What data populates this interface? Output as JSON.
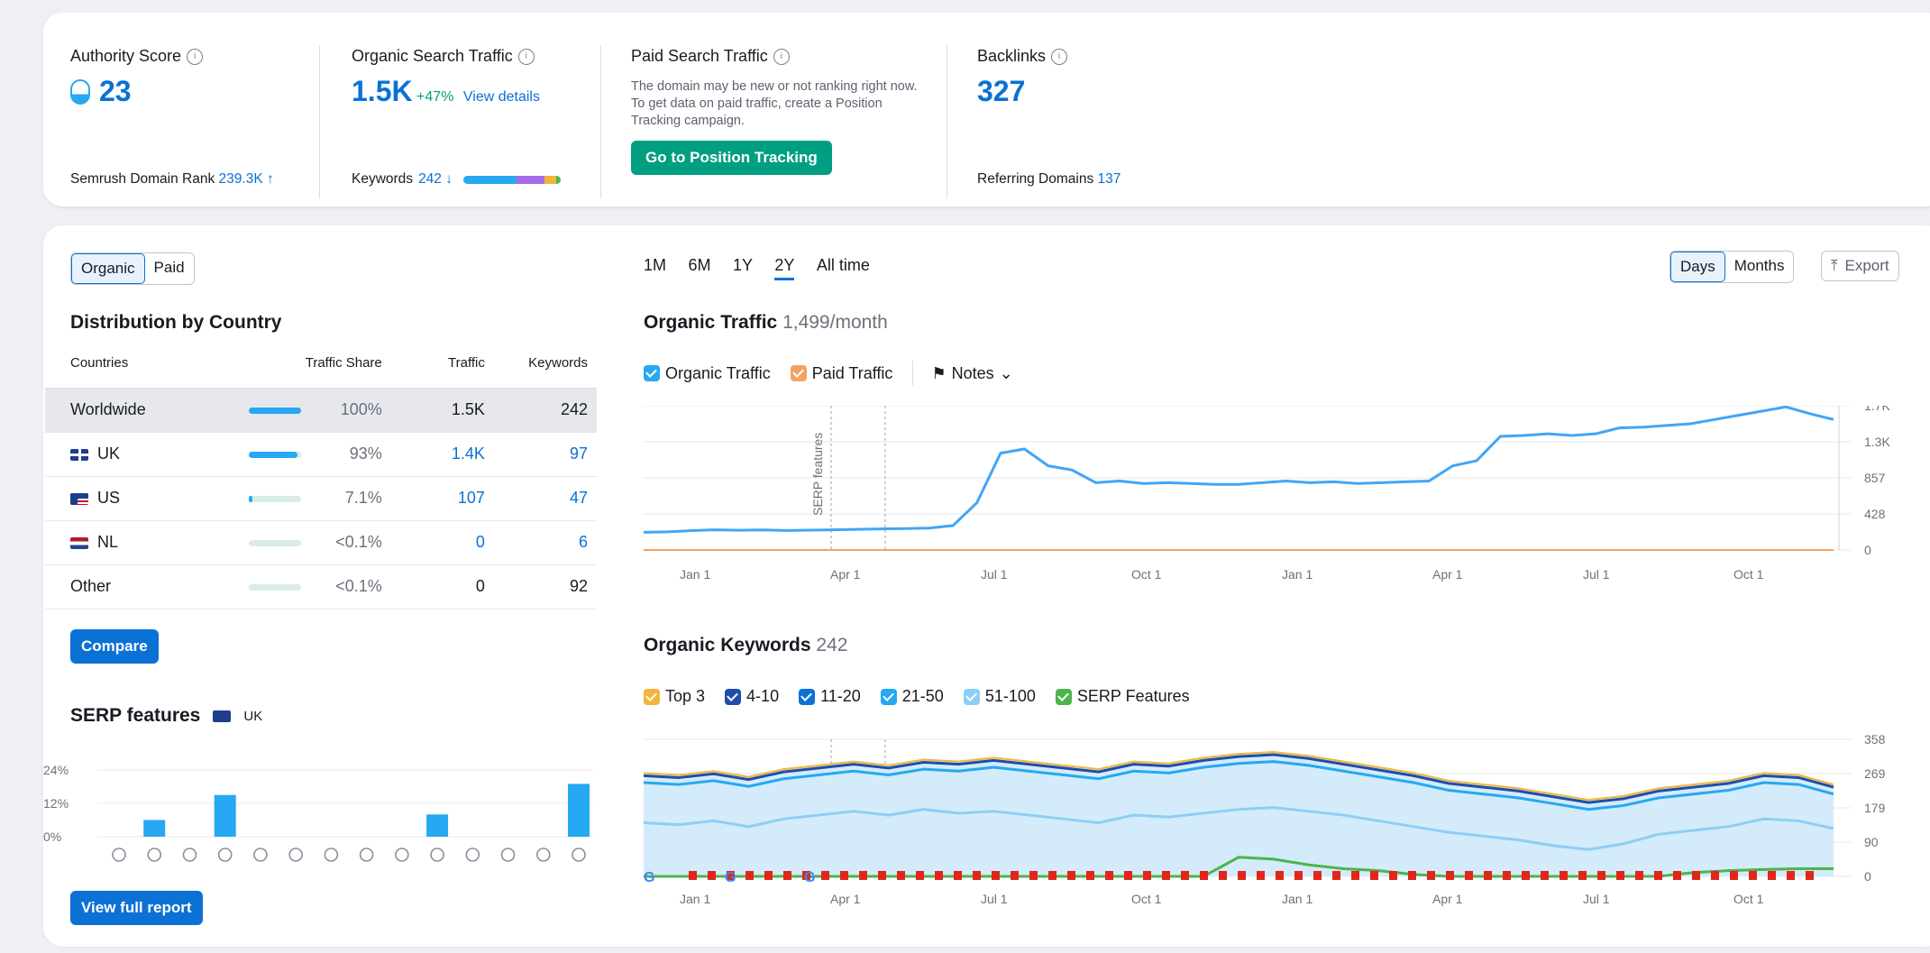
{
  "header": {
    "authority": {
      "label": "Authority Score",
      "value": "23",
      "foot_label": "Semrush Domain Rank",
      "foot_value": "239.3K ↑"
    },
    "organic": {
      "label": "Organic Search Traffic",
      "value": "1.5K",
      "change": "+47%",
      "link": "View details",
      "foot_label": "Keywords",
      "foot_value": "242 ↓"
    },
    "paid": {
      "label": "Paid Search Traffic",
      "text": "The domain may be new or not ranking right now. To get data on paid traffic, create a Position Tracking campaign.",
      "button": "Go to Position Tracking"
    },
    "backlinks": {
      "label": "Backlinks",
      "value": "327",
      "foot_label": "Referring Domains",
      "foot_value": "137"
    }
  },
  "left": {
    "toggle": [
      "Organic",
      "Paid"
    ],
    "dist_title": "Distribution by Country",
    "columns": [
      "Countries",
      "Traffic Share",
      "Traffic",
      "Keywords"
    ],
    "rows": [
      {
        "country": "Worldwide",
        "share": "100%",
        "share_frac": 1.0,
        "traffic": "1.5K",
        "keywords": "242",
        "flag": ""
      },
      {
        "country": "UK",
        "share": "93%",
        "share_frac": 0.93,
        "traffic": "1.4K",
        "keywords": "97",
        "flag": "uk"
      },
      {
        "country": "US",
        "share": "7.1%",
        "share_frac": 0.071,
        "traffic": "107",
        "keywords": "47",
        "flag": "us"
      },
      {
        "country": "NL",
        "share": "<0.1%",
        "share_frac": 0.0,
        "traffic": "0",
        "keywords": "6",
        "flag": "nl"
      },
      {
        "country": "Other",
        "share": "<0.1%",
        "share_frac": 0.0,
        "traffic": "0",
        "keywords": "92",
        "flag": ""
      }
    ],
    "compare": "Compare",
    "serp_title": "SERP features",
    "serp_region": "UK",
    "view_full": "View full report"
  },
  "right": {
    "ranges": [
      "1M",
      "6M",
      "1Y",
      "2Y",
      "All time"
    ],
    "active_range": "2Y",
    "days": "Days",
    "months": "Months",
    "export": "Export",
    "traffic_title": "Organic Traffic",
    "traffic_sub": "1,499/month",
    "traffic_legend": {
      "organic": "Organic Traffic",
      "paid": "Paid Traffic",
      "notes": "Notes"
    },
    "serp_note": "SERP features",
    "kw_title": "Organic Keywords",
    "kw_sub": "242",
    "kw_legend": [
      "Top 3",
      "4-10",
      "11-20",
      "21-50",
      "51-100",
      "SERP Features"
    ]
  },
  "colors": {
    "blue": "#0b71d4",
    "green": "#009f81",
    "line": "#42a5f5",
    "orange": "#f4a261"
  },
  "chart_data": [
    {
      "type": "line",
      "title": "Organic Traffic",
      "x_ticks": [
        "Jan 1",
        "Apr 1",
        "Jul 1",
        "Oct 1",
        "Jan 1",
        "Apr 1",
        "Jul 1",
        "Oct 1"
      ],
      "y_ticks": [
        "1.7K",
        "1.3K",
        "857",
        "428",
        "0"
      ],
      "ylim": [
        0,
        1714
      ],
      "series": [
        {
          "name": "Organic Traffic",
          "values": [
            210,
            215,
            230,
            240,
            235,
            238,
            232,
            236,
            240,
            245,
            250,
            255,
            260,
            290,
            560,
            1150,
            1200,
            1000,
            950,
            800,
            820,
            790,
            800,
            790,
            780,
            780,
            800,
            820,
            800,
            810,
            790,
            800,
            810,
            820,
            1000,
            1060,
            1350,
            1360,
            1380,
            1360,
            1380,
            1450,
            1460,
            1480,
            1500,
            1550,
            1600,
            1650,
            1700,
            1620,
            1550
          ]
        },
        {
          "name": "Paid Traffic",
          "values": [
            0,
            0
          ]
        }
      ]
    },
    {
      "type": "area",
      "title": "Organic Keywords",
      "y_ticks": [
        "358",
        "269",
        "179",
        "90",
        "0"
      ],
      "ylim": [
        0,
        358
      ],
      "series": [
        {
          "name": "Top 3",
          "values": [
            270,
            265,
            275,
            260,
            280,
            290,
            300,
            290,
            305,
            300,
            310,
            300,
            290,
            280,
            300,
            295,
            310,
            320,
            325,
            315,
            300,
            285,
            270,
            250,
            240,
            230,
            215,
            200,
            210,
            230,
            240,
            250,
            270,
            265,
            240
          ]
        },
        {
          "name": "21-50",
          "values": [
            245,
            240,
            250,
            235,
            255,
            265,
            275,
            265,
            280,
            275,
            285,
            275,
            265,
            255,
            275,
            270,
            285,
            295,
            300,
            290,
            275,
            260,
            245,
            225,
            215,
            205,
            190,
            175,
            185,
            205,
            215,
            225,
            245,
            240,
            215
          ]
        },
        {
          "name": "51-100",
          "values": [
            140,
            135,
            145,
            130,
            150,
            160,
            170,
            160,
            175,
            165,
            170,
            160,
            150,
            140,
            160,
            155,
            165,
            175,
            180,
            170,
            160,
            145,
            130,
            115,
            105,
            95,
            80,
            70,
            85,
            110,
            120,
            130,
            150,
            145,
            125
          ]
        },
        {
          "name": "SERP Features",
          "values": [
            0,
            0,
            0,
            0,
            0,
            0,
            0,
            0,
            0,
            0,
            0,
            0,
            0,
            0,
            0,
            0,
            0,
            50,
            45,
            30,
            20,
            15,
            5,
            0,
            0,
            0,
            0,
            0,
            0,
            0,
            10,
            15,
            18,
            20,
            20
          ]
        }
      ]
    },
    {
      "type": "bar",
      "title": "SERP features",
      "y_ticks": [
        "24%",
        "12%",
        "0%"
      ],
      "ylim": [
        0,
        24
      ],
      "values": [
        0,
        6,
        0,
        15,
        0,
        0,
        0,
        0,
        0,
        8,
        0,
        0,
        0,
        19
      ]
    }
  ]
}
